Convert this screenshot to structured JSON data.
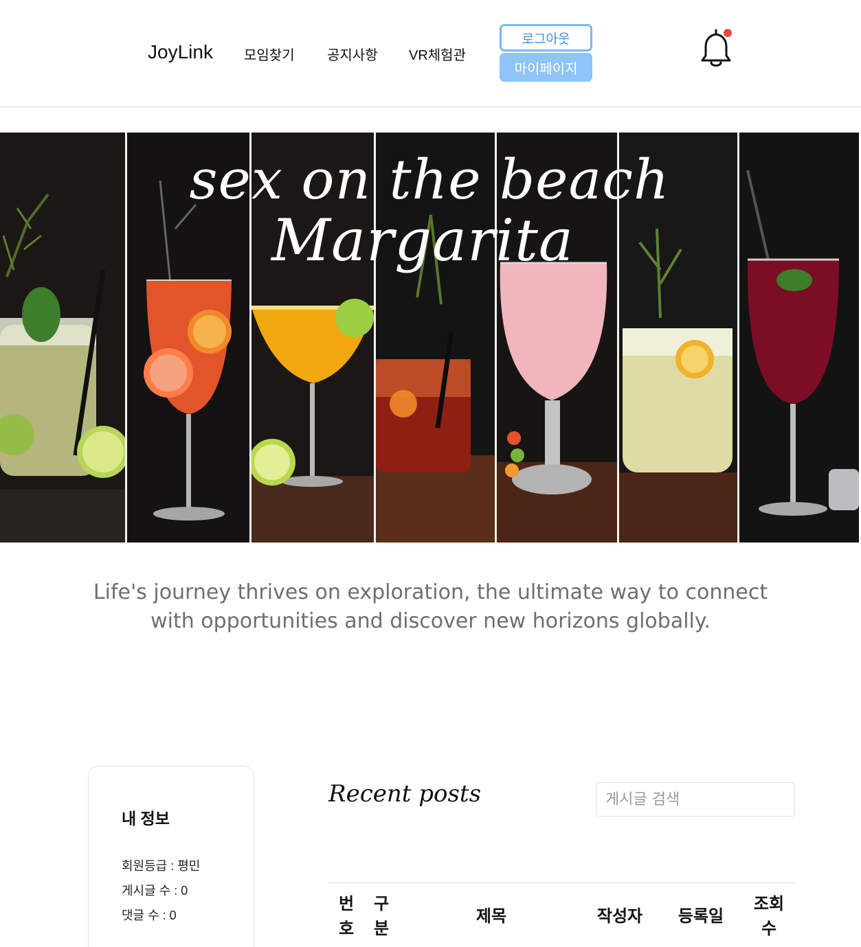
{
  "header": {
    "logo": "JoyLink",
    "nav": [
      "모임찾기",
      "공지사항",
      "VR체험관"
    ],
    "logout_label": "로그아웃",
    "mypage_label": "마이페이지",
    "notification_icon": "bell-icon"
  },
  "hero": {
    "line1": "sex on the beach",
    "line2": "Margarita"
  },
  "tagline": "Life's journey thrives on exploration, the ultimate way to connect with opportunities and discover new horizons globally.",
  "info": {
    "title": "내 정보",
    "grade": "회원등급 : 평민",
    "posts": "게시글 수 : 0",
    "comments": "댓글 수 : 0"
  },
  "posts": {
    "heading": "Recent posts",
    "search_placeholder": "게시글 검색",
    "columns": [
      "번호",
      "구분",
      "제목",
      "작성자",
      "등록일",
      "조회수"
    ],
    "column_lines": {
      "num": [
        "번",
        "호"
      ],
      "cat": [
        "구",
        "분"
      ],
      "views": [
        "조회",
        "수"
      ]
    }
  },
  "colors": {
    "accent_blue": "#7ab7f5",
    "button_fill": "#8ec4f7",
    "notification_dot": "#f0473f",
    "hero_bg": "#15110f"
  }
}
